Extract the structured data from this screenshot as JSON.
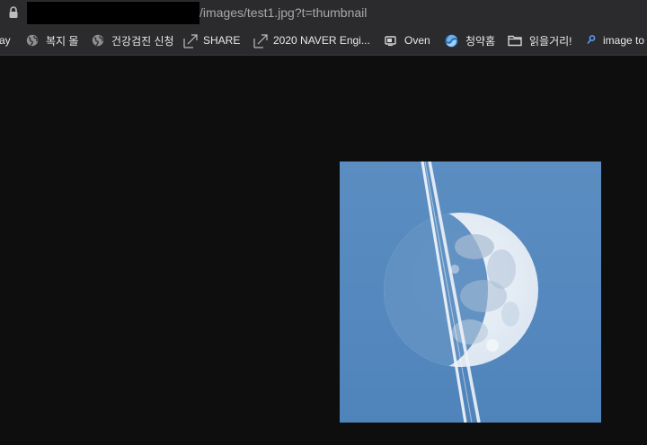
{
  "browser": {
    "url_path": "/images/test1.jpg?t=thumbnail"
  },
  "bookmarks": [
    {
      "label": "ay",
      "icon": "none"
    },
    {
      "label": "복지 몰",
      "icon": "globe-icon"
    },
    {
      "label": "건강검진 신청",
      "icon": "globe-icon"
    },
    {
      "label": "SHARE",
      "icon": "external-link-icon"
    },
    {
      "label": "2020 NAVER Engi...",
      "icon": "external-link-icon"
    },
    {
      "label": "Oven",
      "icon": "oven-icon"
    },
    {
      "label": "청약홈",
      "icon": "swirl-logo-icon"
    },
    {
      "label": "읽을거리!",
      "icon": "folder-icon"
    },
    {
      "label": "image to",
      "icon": "pin-icon"
    }
  ],
  "image": {
    "subject": "moon-with-airplane-contrails",
    "colors": {
      "sky": "#5a8cc0",
      "moon": "#e4ecf4"
    }
  }
}
